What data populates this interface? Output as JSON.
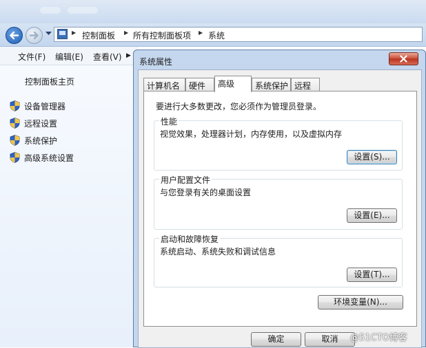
{
  "breadcrumb": [
    "控制面板",
    "所有控制面板项",
    "系统"
  ],
  "menubar": {
    "file": "文件(F)",
    "edit": "编辑(E)",
    "view": "查看(V)"
  },
  "sidebar": {
    "home": "控制面板主页",
    "items": [
      {
        "label": "设备管理器",
        "icon": "uac-shield-icon"
      },
      {
        "label": "远程设置",
        "icon": "uac-shield-icon"
      },
      {
        "label": "系统保护",
        "icon": "uac-shield-icon"
      },
      {
        "label": "高级系统设置",
        "icon": "uac-shield-icon"
      }
    ]
  },
  "dialog": {
    "title": "系统属性",
    "tabs": [
      "计算机名",
      "硬件",
      "高级",
      "系统保护",
      "远程"
    ],
    "active_tab": "高级",
    "intro": "要进行大多数更改，您必须作为管理员登录。",
    "groups": [
      {
        "title": "性能",
        "desc": "视觉效果，处理器计划，内存使用，以及虚拟内存",
        "button": "设置(S)..."
      },
      {
        "title": "用户配置文件",
        "desc": "与您登录有关的桌面设置",
        "button": "设置(E)..."
      },
      {
        "title": "启动和故障恢复",
        "desc": "系统启动、系统失败和调试信息",
        "button": "设置(T)..."
      }
    ],
    "env_button": "环境变量(N)...",
    "ok": "确定",
    "cancel": "取消"
  },
  "watermark": "@51CTO博客",
  "colors": {
    "chrome": "#c9daf0",
    "dialog_frame": "#c4d7ee",
    "close_button": "#c94a33",
    "focus_border": "#3c7fb1"
  }
}
